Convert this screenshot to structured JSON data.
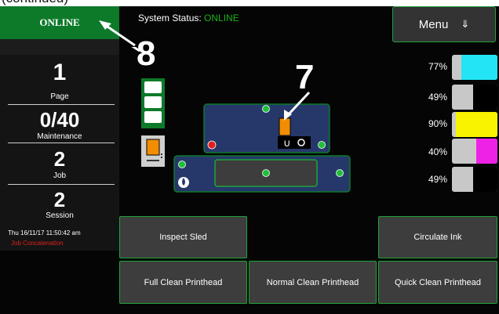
{
  "caption_partial": "(continued)",
  "status": {
    "online_label": "ONLINE",
    "system_status_label": "System Status:",
    "system_status_value": "ONLINE"
  },
  "stats": [
    {
      "value": "1",
      "label": "Page"
    },
    {
      "value": "0/40",
      "label": "Maintenance"
    },
    {
      "value": "2",
      "label": "Job"
    },
    {
      "value": "2",
      "label": "Session"
    }
  ],
  "timestamp": "Thu 16/11/17 11:50:42 am",
  "job_concatenation": "Job Concatenation",
  "menu": {
    "label": "Menu",
    "arrow": "⇓"
  },
  "callouts": {
    "online": "8",
    "sled": "7"
  },
  "ink_levels": [
    {
      "percent": "77%",
      "fraction": 0.77,
      "color": "#22e4f4"
    },
    {
      "percent": "49%",
      "fraction": 0.49,
      "color": "#000000"
    },
    {
      "percent": "90%",
      "fraction": 0.9,
      "color": "#f8f400"
    },
    {
      "percent": "40%",
      "fraction": 0.4,
      "color": "#ee22e6"
    },
    {
      "percent": "49%",
      "fraction": 0.49,
      "color": "#000000"
    }
  ],
  "actions": {
    "inspect_sled": "Inspect Sled",
    "circulate_ink": "Circulate Ink",
    "full_clean": "Full Clean Printhead",
    "normal_clean": "Normal Clean Printhead",
    "quick_clean": "Quick Clean Printhead"
  },
  "colors": {
    "accent_green": "#1fa33a",
    "online_bg": "#0d7a2a",
    "panel_blue": "#26386a",
    "alert_red": "#e02020"
  }
}
